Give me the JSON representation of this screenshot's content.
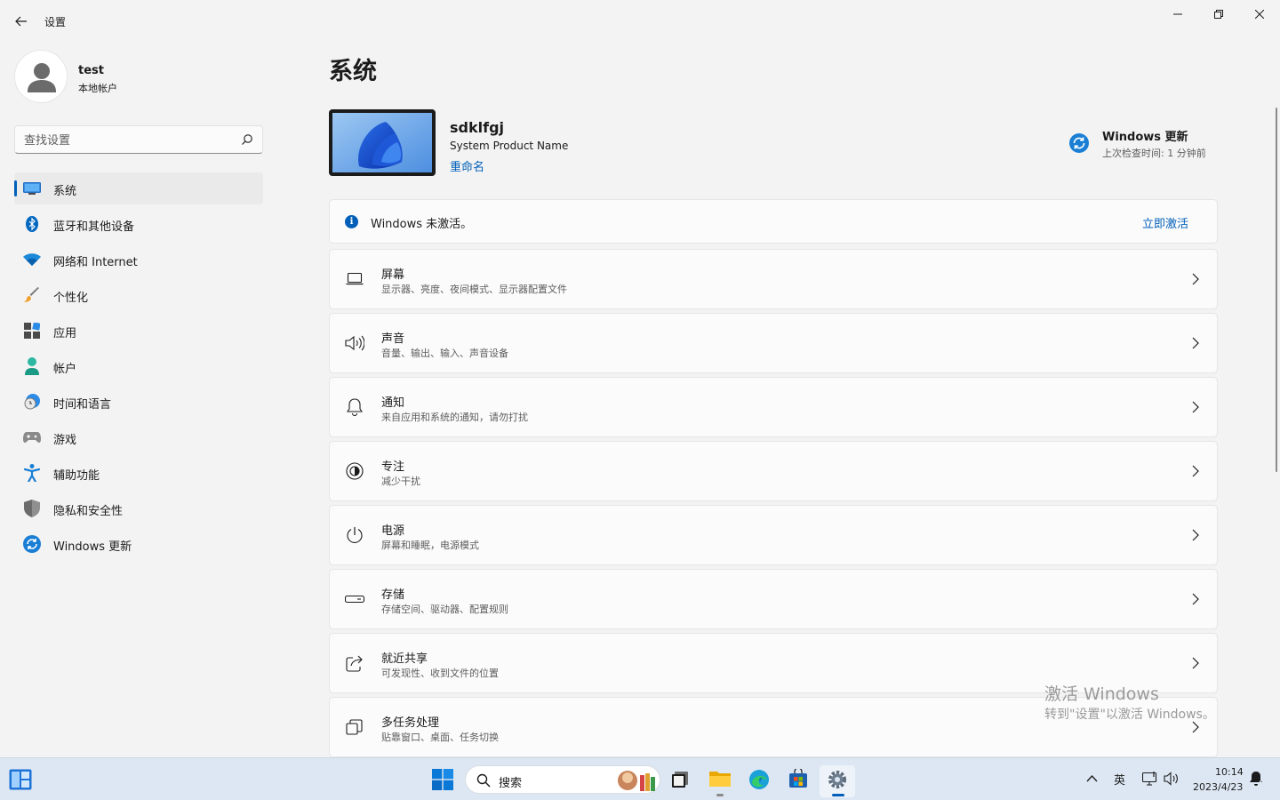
{
  "window": {
    "app_title": "设置"
  },
  "profile": {
    "name": "test",
    "account_type": "本地帐户"
  },
  "search": {
    "placeholder": "查找设置"
  },
  "sidebar": {
    "items": [
      {
        "label": "系统",
        "icon": "system-display-icon",
        "active": true
      },
      {
        "label": "蓝牙和其他设备",
        "icon": "bluetooth-icon"
      },
      {
        "label": "网络和 Internet",
        "icon": "wifi-icon"
      },
      {
        "label": "个性化",
        "icon": "paintbrush-icon"
      },
      {
        "label": "应用",
        "icon": "apps-icon"
      },
      {
        "label": "帐户",
        "icon": "account-icon"
      },
      {
        "label": "时间和语言",
        "icon": "time-language-icon"
      },
      {
        "label": "游戏",
        "icon": "gamepad-icon"
      },
      {
        "label": "辅助功能",
        "icon": "accessibility-icon"
      },
      {
        "label": "隐私和安全性",
        "icon": "shield-icon"
      },
      {
        "label": "Windows 更新",
        "icon": "windows-update-icon"
      }
    ]
  },
  "main": {
    "title": "系统",
    "device": {
      "name": "sdklfgj",
      "model": "System Product Name",
      "rename": "重命名"
    },
    "windows_update": {
      "title": "Windows 更新",
      "status": "上次检查时间: 1 分钟前"
    },
    "activation_banner": {
      "text": "Windows 未激活。",
      "action": "立即激活"
    },
    "cards": [
      {
        "title": "屏幕",
        "subtitle": "显示器、亮度、夜间模式、显示器配置文件",
        "icon": "laptop-icon"
      },
      {
        "title": "声音",
        "subtitle": "音量、输出、输入、声音设备",
        "icon": "speaker-icon"
      },
      {
        "title": "通知",
        "subtitle": "来自应用和系统的通知，请勿打扰",
        "icon": "bell-icon"
      },
      {
        "title": "专注",
        "subtitle": "减少干扰",
        "icon": "focus-icon"
      },
      {
        "title": "电源",
        "subtitle": "屏幕和睡眠，电源模式",
        "icon": "power-icon"
      },
      {
        "title": "存储",
        "subtitle": "存储空间、驱动器、配置规则",
        "icon": "storage-icon"
      },
      {
        "title": "就近共享",
        "subtitle": "可发现性、收到文件的位置",
        "icon": "share-icon"
      },
      {
        "title": "多任务处理",
        "subtitle": "贴靠窗口、桌面、任务切换",
        "icon": "multitask-icon"
      }
    ]
  },
  "watermark": {
    "line1": "激活 Windows",
    "line2": "转到\"设置\"以激活 Windows。"
  },
  "taskbar": {
    "search_label": "搜索",
    "language": "英",
    "time": "10:14",
    "date": "2023/4/23"
  },
  "colors": {
    "accent": "#005fb8",
    "background": "#f3f3f3",
    "card": "#fbfbfb"
  }
}
